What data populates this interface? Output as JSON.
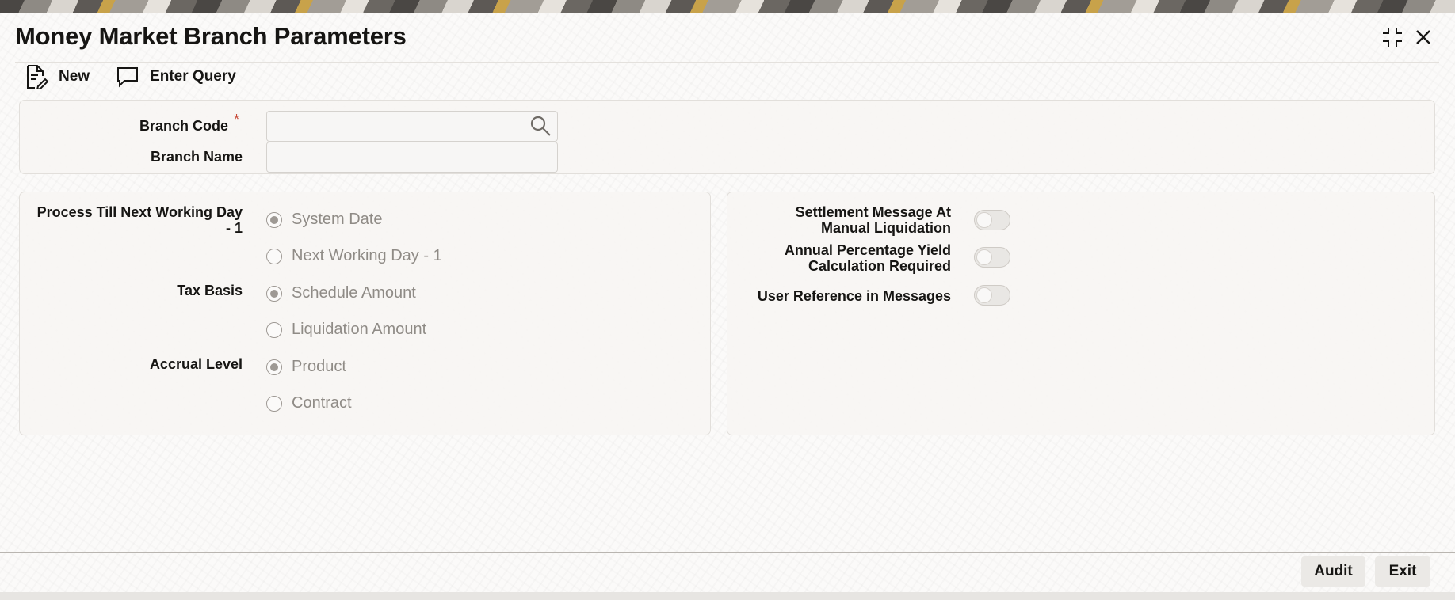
{
  "window": {
    "title": "Money Market Branch Parameters",
    "minimize_icon": "collapse-icon",
    "close_icon": "close-icon"
  },
  "toolbar": {
    "new_label": "New",
    "new_icon": "new-document-icon",
    "enter_query_label": "Enter Query",
    "enter_query_icon": "speech-bubble-icon"
  },
  "header": {
    "branch_code_label": "Branch Code",
    "branch_code_required": "*",
    "branch_code_value": "",
    "branch_name_label": "Branch Name",
    "branch_name_value": ""
  },
  "left_panel": {
    "process_till": {
      "label_line1": "Process Till Next Working Day",
      "label_line2": "- 1",
      "options": [
        {
          "label": "System Date",
          "selected": true
        },
        {
          "label": "Next Working Day - 1",
          "selected": false
        }
      ]
    },
    "tax_basis": {
      "label": "Tax Basis",
      "options": [
        {
          "label": "Schedule Amount",
          "selected": true
        },
        {
          "label": "Liquidation Amount",
          "selected": false
        }
      ]
    },
    "accrual_level": {
      "label": "Accrual Level",
      "options": [
        {
          "label": "Product",
          "selected": true
        },
        {
          "label": "Contract",
          "selected": false
        }
      ]
    }
  },
  "right_panel": {
    "settlement": {
      "label_line1": "Settlement Message At",
      "label_line2": "Manual Liquidation",
      "on": false
    },
    "apy": {
      "label_line1": "Annual Percentage Yield",
      "label_line2": "Calculation Required",
      "on": false
    },
    "user_ref": {
      "label": "User Reference in Messages",
      "on": false
    }
  },
  "footer": {
    "audit_label": "Audit",
    "exit_label": "Exit"
  },
  "colors": {
    "required": "#c74634",
    "text": "#161513",
    "muted": "#8f8b86"
  }
}
